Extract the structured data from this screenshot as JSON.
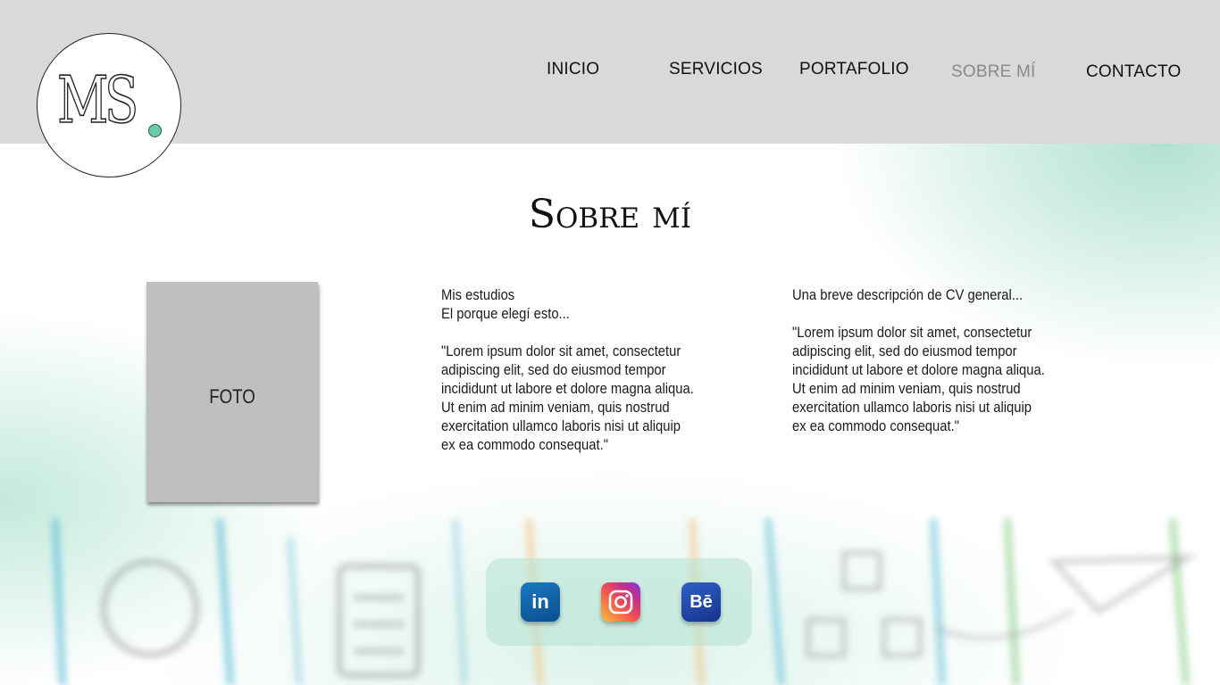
{
  "logo": {
    "text": "MS"
  },
  "nav": {
    "items": [
      {
        "label": "INICIO"
      },
      {
        "label": "SERVICIOS"
      },
      {
        "label": "PORTAFOLIO"
      },
      {
        "label": "SOBRE MÍ",
        "active": true
      },
      {
        "label": "CONTACTO"
      }
    ]
  },
  "main": {
    "title": "Sobre mí",
    "photo_label": "FOTO",
    "column1": "Mis estudios\nEl porque elegí esto...\n\n\"Lorem ipsum dolor sit amet, consectetur\nadipiscing elit, sed do eiusmod tempor\nincididunt ut labore et dolore magna aliqua.\nUt enim ad minim veniam, quis nostrud\nexercitation ullamco laboris nisi ut aliquip\nex ea commodo consequat.\"",
    "column2": "Una breve descripción de CV general...\n\n\"Lorem ipsum dolor sit amet, consectetur\nadipiscing elit, sed do eiusmod tempor\nincididunt ut labore et dolore magna aliqua.\nUt enim ad minim veniam, quis nostrud\nexercitation ullamco laboris nisi ut aliquip\nex ea commodo consequat.\""
  },
  "social": {
    "linkedin": {
      "glyph": "in",
      "icon": "linkedin-icon",
      "color": "#0e5fa8"
    },
    "instagram": {
      "icon": "instagram-icon",
      "color": "#e1306c"
    },
    "behance": {
      "glyph": "Bē",
      "icon": "behance-icon",
      "color": "#1f4bb0"
    }
  },
  "colors": {
    "header_bg": "#d9d9d9",
    "accent_mint": "#6cc9a6",
    "nav_active": "#8a8a8a"
  }
}
